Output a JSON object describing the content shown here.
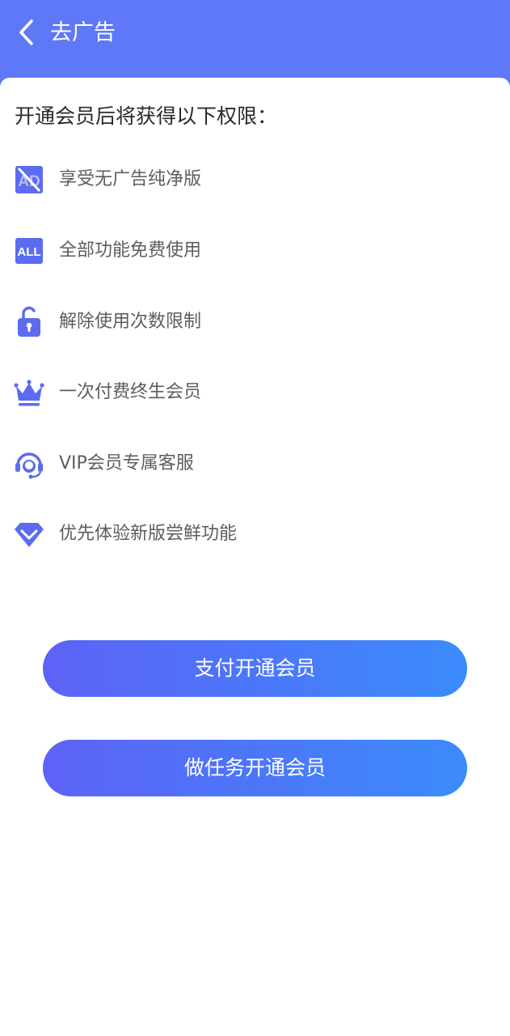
{
  "header": {
    "title": "去广告",
    "back_icon": "chevron-left-icon"
  },
  "perks": {
    "title": "开通会员后将获得以下权限：",
    "items": [
      {
        "icon": "no-ad-icon",
        "label": "享受无广告纯净版"
      },
      {
        "icon": "all-badge-icon",
        "label": "全部功能免费使用"
      },
      {
        "icon": "unlock-icon",
        "label": "解除使用次数限制"
      },
      {
        "icon": "crown-icon",
        "label": "一次付费终生会员"
      },
      {
        "icon": "headset-icon",
        "label": "VIP会员专属客服"
      },
      {
        "icon": "diamond-icon",
        "label": "优先体验新版尝鲜功能"
      }
    ]
  },
  "actions": {
    "pay_label": "支付开通会员",
    "task_label": "做任务开通会员"
  },
  "colors": {
    "header": "#5f78f7",
    "icon": "#5b6cf1",
    "button_start": "#5d62f6",
    "button_end": "#3b8bfb"
  }
}
